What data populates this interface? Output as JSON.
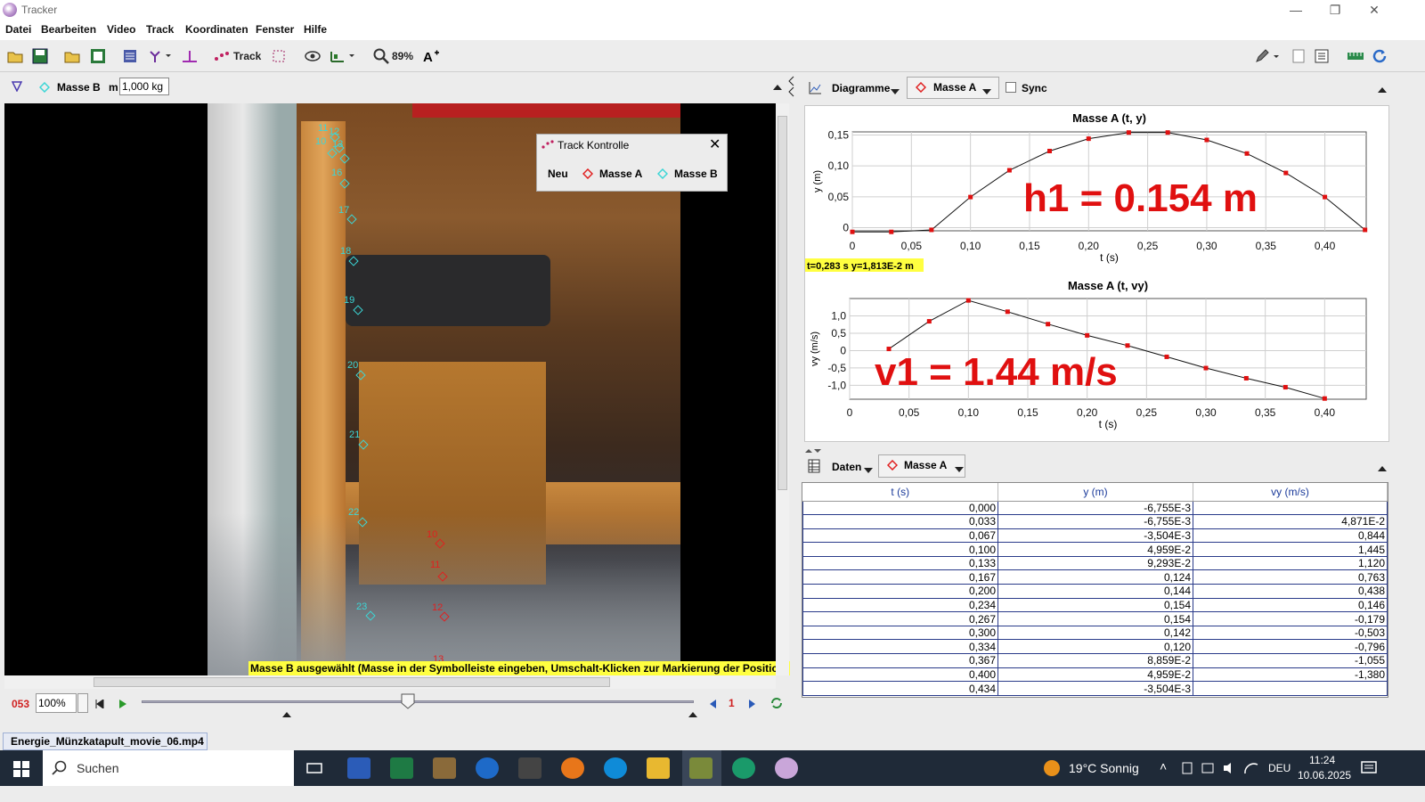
{
  "window": {
    "title": "Tracker",
    "controls": [
      "—",
      "❐",
      "✕"
    ]
  },
  "menu": [
    "Datei",
    "Bearbeiten",
    "Video",
    "Track",
    "Koordinaten",
    "Fenster",
    "Hilfe"
  ],
  "toolbar": {
    "track_label": "Track",
    "zoom": "89%"
  },
  "leftbar": {
    "track_name": "Masse B",
    "mass_label": "m",
    "mass_value": "1,000 kg"
  },
  "track_control": {
    "title": "Track Kontrolle",
    "new_label": "Neu",
    "track_a": "Masse A",
    "track_b": "Masse B"
  },
  "video": {
    "status_message": "Masse B ausgewählt (Masse in der Symbolleiste eingeben, Umschalt-Klicken zur Markierung der Position)",
    "points_b": [
      "11",
      "12",
      "10",
      "13",
      "16",
      "17",
      "18",
      "19",
      "20",
      "21",
      "22",
      "23"
    ],
    "points_a": [
      "10",
      "11",
      "12",
      "13"
    ]
  },
  "player": {
    "frame": "053",
    "rate": "100%",
    "step": "1"
  },
  "file_tab": "Energie_Münzkatapult_movie_06.mp4",
  "plots_header": {
    "menu_label": "Diagramme",
    "track": "Masse A",
    "sync": "Sync"
  },
  "chart_data": [
    {
      "type": "line",
      "title": "Masse A (t, y)",
      "xlabel": "t (s)",
      "ylabel": "y (m)",
      "x": [
        0.0,
        0.033,
        0.067,
        0.1,
        0.133,
        0.167,
        0.2,
        0.234,
        0.267,
        0.3,
        0.334,
        0.367,
        0.4,
        0.434
      ],
      "y": [
        -0.006755,
        -0.006755,
        -0.003504,
        0.04959,
        0.09293,
        0.124,
        0.144,
        0.154,
        0.154,
        0.142,
        0.12,
        0.08859,
        0.04959,
        -0.003504
      ],
      "xlim": [
        0,
        0.435
      ],
      "ylim": [
        -0.005,
        0.155
      ],
      "xticks": [
        "0",
        "0,05",
        "0,10",
        "0,15",
        "0,20",
        "0,25",
        "0,30",
        "0,35",
        "0,40"
      ],
      "yticks": [
        "0",
        "0,05",
        "0,10",
        "0,15"
      ],
      "annotation": "h1 = 0.154 m",
      "readout": "t=0,283 s  y=1,813E-2 m"
    },
    {
      "type": "line",
      "title": "Masse A (t, vy)",
      "xlabel": "t (s)",
      "ylabel": "vy (m/s)",
      "x": [
        0.033,
        0.067,
        0.1,
        0.133,
        0.167,
        0.2,
        0.234,
        0.267,
        0.3,
        0.334,
        0.367,
        0.4
      ],
      "y": [
        0.04871,
        0.844,
        1.445,
        1.12,
        0.763,
        0.438,
        0.146,
        -0.179,
        -0.503,
        -0.796,
        -1.055,
        -1.38
      ],
      "xlim": [
        0,
        0.435
      ],
      "ylim": [
        -1.4,
        1.5
      ],
      "xticks": [
        "0",
        "0,05",
        "0,10",
        "0,15",
        "0,20",
        "0,25",
        "0,30",
        "0,35",
        "0,40"
      ],
      "yticks": [
        "1,0",
        "0,5",
        "0",
        "-0,5",
        "-1,0"
      ],
      "annotation": "v1 = 1.44 m/s"
    }
  ],
  "data_header": {
    "menu_label": "Daten",
    "track": "Masse A"
  },
  "table": {
    "columns": [
      "t (s)",
      "y (m)",
      "vy (m/s)"
    ],
    "rows": [
      [
        "0,000",
        "-6,755E-3",
        ""
      ],
      [
        "0,033",
        "-6,755E-3",
        "4,871E-2"
      ],
      [
        "0,067",
        "-3,504E-3",
        "0,844"
      ],
      [
        "0,100",
        "4,959E-2",
        "1,445"
      ],
      [
        "0,133",
        "9,293E-2",
        "1,120"
      ],
      [
        "0,167",
        "0,124",
        "0,763"
      ],
      [
        "0,200",
        "0,144",
        "0,438"
      ],
      [
        "0,234",
        "0,154",
        "0,146"
      ],
      [
        "0,267",
        "0,154",
        "-0,179"
      ],
      [
        "0,300",
        "0,142",
        "-0,503"
      ],
      [
        "0,334",
        "0,120",
        "-0,796"
      ],
      [
        "0,367",
        "8,859E-2",
        "-1,055"
      ],
      [
        "0,400",
        "4,959E-2",
        "-1,380"
      ],
      [
        "0,434",
        "-3,504E-3",
        ""
      ]
    ]
  },
  "taskbar": {
    "search": "Suchen",
    "weather": "19°C  Sonnig",
    "lang": "DEU",
    "time": "11:24",
    "date": "10.06.2025"
  },
  "colors": {
    "accent_red": "#e01010",
    "point_cyan": "#3cd6d6",
    "status_yellow": "#ffff40"
  }
}
